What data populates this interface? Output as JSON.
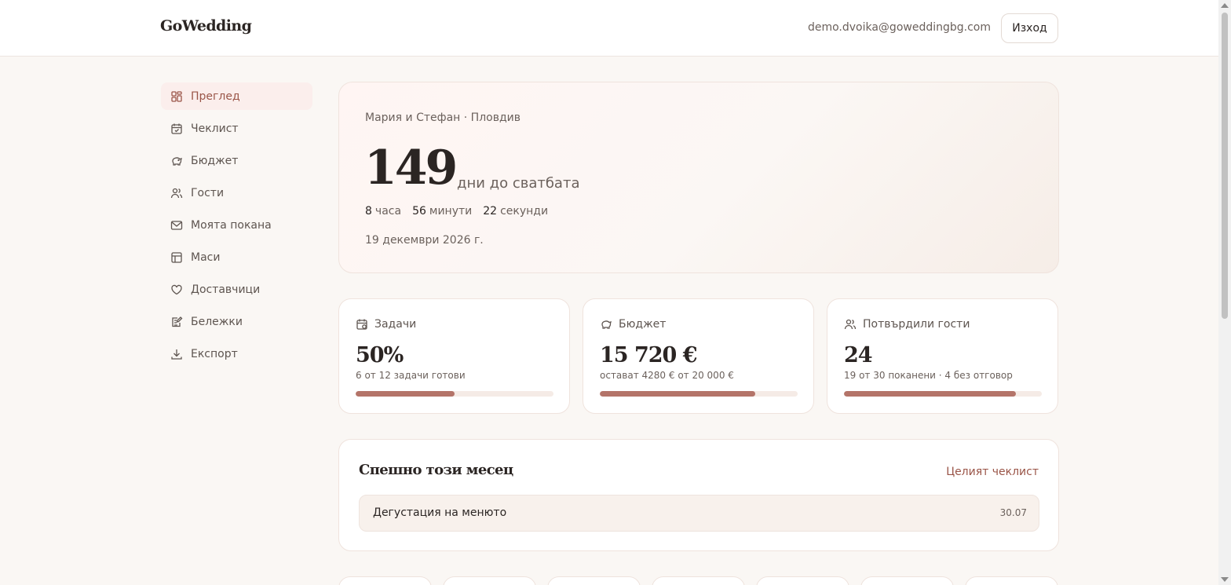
{
  "header": {
    "brand": "GoWedding",
    "user_email": "demo.dvoika@goweddingbg.com",
    "logout_label": "Изход"
  },
  "sidebar": {
    "items": [
      {
        "label": "Преглед",
        "icon": "dashboard-icon",
        "active": true
      },
      {
        "label": "Чеклист",
        "icon": "calendar-check-icon"
      },
      {
        "label": "Бюджет",
        "icon": "piggy-bank-icon"
      },
      {
        "label": "Гости",
        "icon": "users-icon"
      },
      {
        "label": "Моята покана",
        "icon": "mail-icon"
      },
      {
        "label": "Маси",
        "icon": "table-icon"
      },
      {
        "label": "Доставчици",
        "icon": "heart-icon"
      },
      {
        "label": "Бележки",
        "icon": "notebook-icon"
      },
      {
        "label": "Експорт",
        "icon": "download-icon"
      }
    ]
  },
  "hero": {
    "couple": "Мария и Стефан · Пловдив",
    "days": "149",
    "days_label": "дни до сватбата",
    "hours_value": "8",
    "hours_label": "часа",
    "minutes_value": "56",
    "minutes_label": "минути",
    "seconds_value": "22",
    "seconds_label": "секунди",
    "date": "19 декември 2026 г."
  },
  "stats": {
    "tasks": {
      "title": "Задачи",
      "icon": "calendar-icon",
      "value": "50%",
      "sub": "6 от 12 задачи готови",
      "progress": 0.5
    },
    "budget": {
      "title": "Бюджет",
      "icon": "piggy-bank-icon",
      "value": "15 720 €",
      "sub": "остават 4280 € от 20 000 €",
      "progress": 0.786
    },
    "guests": {
      "title": "Потвърдили гости",
      "icon": "users-icon",
      "value": "24",
      "sub": "19 от 30 поканени · 4 без отговор",
      "progress": 0.87
    }
  },
  "urgent": {
    "title": "Спешно този месец",
    "link_label": "Целият чеклист",
    "tasks": [
      {
        "name": "Дегустация на менюто",
        "date": "30.07"
      }
    ]
  },
  "colors": {
    "accent": "#b47469",
    "accent_text": "#9a5548",
    "background": "#faf7f4"
  }
}
